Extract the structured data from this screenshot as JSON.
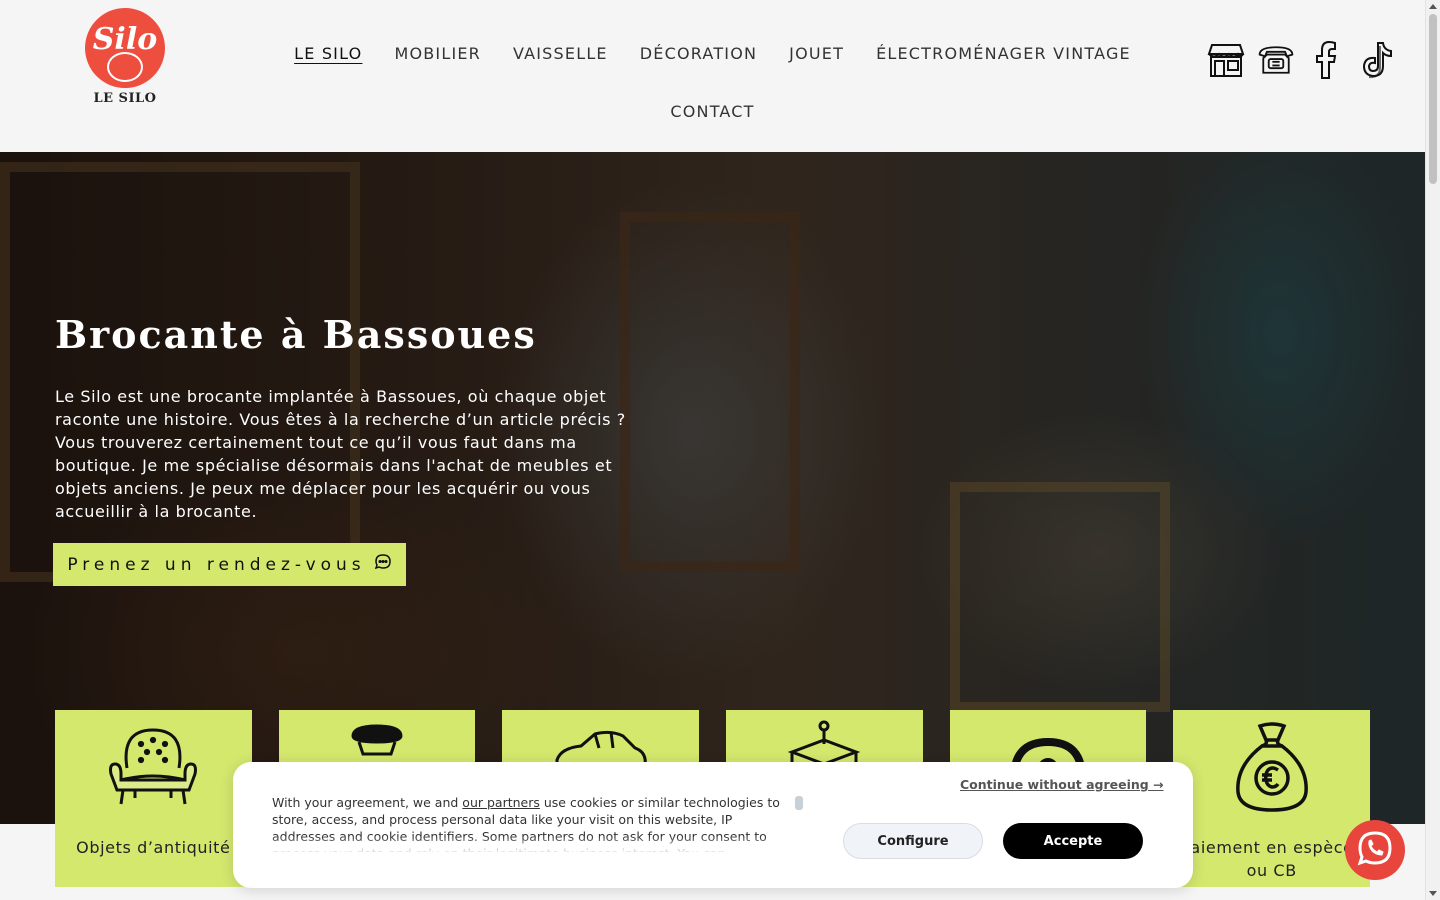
{
  "brand": {
    "logo_script": "Silo",
    "name": "LE SILO"
  },
  "nav": {
    "items": [
      {
        "label": "LE SILO",
        "active": true
      },
      {
        "label": "MOBILIER"
      },
      {
        "label": "VAISSELLE"
      },
      {
        "label": "DÉCORATION"
      },
      {
        "label": "JOUET"
      },
      {
        "label": "ÉLECTROMÉNAGER VINTAGE"
      }
    ],
    "contact": "CONTACT"
  },
  "social_icons": [
    "shop-icon",
    "telephone-icon",
    "facebook-icon",
    "tiktok-icon"
  ],
  "hero": {
    "title": "Brocante à Bassoues",
    "text": "Le Silo est une brocante implantée à Bassoues, où chaque objet raconte une histoire. Vous êtes à la recherche d’un article précis ? Vous trouverez certainement tout ce qu’il vous faut dans ma boutique. Je me spécialise désormais dans l'achat de meubles et objets anciens. Je peux me déplacer pour les acquérir ou vous accueillir à la brocante.",
    "cta": "Prenez un rendez-vous"
  },
  "cards": [
    {
      "label": "Objets d’antiquité",
      "icon": "armchair-icon"
    },
    {
      "label": "",
      "icon": "lamp-icon"
    },
    {
      "label": "",
      "icon": "car-icon"
    },
    {
      "label": "",
      "icon": "delivery-icon"
    },
    {
      "label": "",
      "icon": "record-icon"
    },
    {
      "label": "Paiement en espèces ou CB",
      "icon": "money-bag-icon"
    }
  ],
  "cookie": {
    "text_before_link": "With your agreement, we and ",
    "link": "our partners",
    "text_after_link": " use cookies or similar technologies to store, access, and process personal data like your visit on this website, IP addresses and cookie identifiers. Some partners do not ask for your consent to process your data and rely on their legitimate business interest. You can",
    "continue": "Continue without agreeing →",
    "configure": "Configure",
    "accept": "Accepte"
  },
  "colors": {
    "accent": "#d4e86e",
    "brand_red": "#ee4e3e",
    "whatsapp_bg": "#e8453c"
  }
}
